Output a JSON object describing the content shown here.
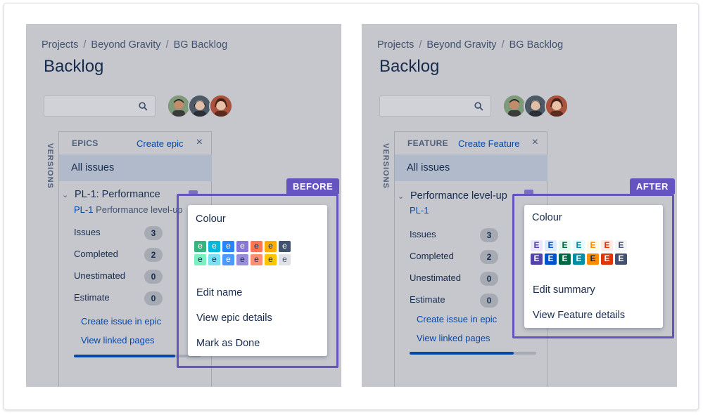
{
  "breadcrumb": [
    "Projects",
    "Beyond Gravity",
    "BG Backlog"
  ],
  "page_title": "Backlog",
  "versions_label": "VERSIONS",
  "all_issues": "All issues",
  "stats": [
    {
      "label": "Issues",
      "count": "3"
    },
    {
      "label": "Completed",
      "count": "2"
    },
    {
      "label": "Unestimated",
      "count": "0"
    },
    {
      "label": "Estimate",
      "count": "0"
    }
  ],
  "links": {
    "create_issue": "Create issue in epic",
    "view_linked": "View linked pages"
  },
  "close_symbol": "×",
  "before": {
    "tag": "BEFORE",
    "section_header": "EPICS",
    "create_link": "Create epic",
    "epic_name": "PL-1: Performance",
    "epic_key": "PL-1",
    "epic_subtitle": "Performance level-up",
    "progress": 0.8,
    "menu": {
      "title": "Colour",
      "swatch_letter": "e",
      "items": [
        "Edit name",
        "View epic details",
        "Mark as Done"
      ]
    }
  },
  "after": {
    "tag": "AFTER",
    "section_header": "FEATURE",
    "create_link": "Create Feature",
    "epic_name": "Performance level-up",
    "epic_key": "PL-1",
    "progress": 0.82,
    "menu": {
      "title": "Colour",
      "swatch_letter": "E",
      "items": [
        "Edit summary",
        "View Feature details"
      ]
    }
  },
  "colors": {
    "accent": "#6554c0",
    "link": "#0747a6",
    "before_row1": [
      "#36b37e",
      "#00b8d9",
      "#2684ff",
      "#8777d9",
      "#ff7452",
      "#ffab00",
      "#42526e"
    ],
    "before_row2": [
      "#79f2c0",
      "#79e2f2",
      "#4c9aff",
      "#998dd9",
      "#ff8f73",
      "#ffc400",
      "#dfe1e6"
    ],
    "after_row1": [
      "#eae6ff",
      "#deebff",
      "#e3fcef",
      "#e6fcff",
      "#fffae6",
      "#ffebe6",
      "#f4f5f7"
    ],
    "after_row2": [
      "#5243aa",
      "#0052cc",
      "#006644",
      "#008da6",
      "#ff8b00",
      "#de350b",
      "#42526e"
    ]
  }
}
